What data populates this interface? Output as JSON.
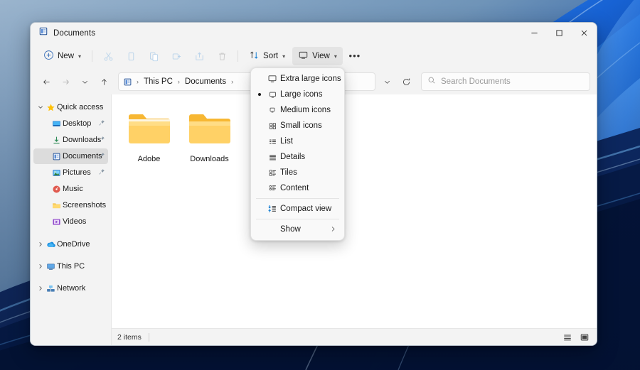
{
  "window": {
    "title": "Documents",
    "title_icon": "documents-folder-icon",
    "controls": {
      "minimize": "minimize-icon",
      "maximize": "maximize-icon",
      "close": "close-icon"
    }
  },
  "toolbar": {
    "new_label": "New",
    "new_icon": "plus-circle-icon",
    "actions": [
      {
        "name": "cut-button",
        "icon": "scissors-icon",
        "disabled": true
      },
      {
        "name": "copy-button",
        "icon": "copy-icon",
        "disabled": true
      },
      {
        "name": "paste-button",
        "icon": "paste-icon",
        "disabled": true
      },
      {
        "name": "rename-button",
        "icon": "rename-icon",
        "disabled": true
      },
      {
        "name": "share-button",
        "icon": "share-icon",
        "disabled": true
      },
      {
        "name": "delete-button",
        "icon": "trash-icon",
        "disabled": true
      }
    ],
    "sort_label": "Sort",
    "sort_icon": "sort-arrows-icon",
    "view_label": "View",
    "view_icon": "monitor-icon",
    "more_label": "•••",
    "view_active": true
  },
  "address": {
    "back_icon": "arrow-left-icon",
    "forward_icon": "arrow-right-icon",
    "recent_icon": "chevron-down-icon",
    "up_icon": "arrow-up-icon",
    "path_icon": "documents-folder-icon",
    "crumbs": [
      "This PC",
      "Documents"
    ],
    "separator": "›",
    "dropdown_icon": "chevron-down-icon",
    "refresh_icon": "refresh-icon"
  },
  "search": {
    "icon": "search-icon",
    "placeholder": "Search Documents",
    "value": ""
  },
  "sidebar": {
    "items": [
      {
        "label": "Quick access",
        "icon": "star-icon",
        "expandable": true,
        "expanded": true,
        "child": false,
        "pinned": false,
        "selected": false
      },
      {
        "label": "Desktop",
        "icon": "desktop-icon",
        "expandable": false,
        "expanded": false,
        "child": true,
        "pinned": true,
        "selected": false
      },
      {
        "label": "Downloads",
        "icon": "downloads-icon",
        "expandable": false,
        "expanded": false,
        "child": true,
        "pinned": true,
        "selected": false
      },
      {
        "label": "Documents",
        "icon": "documents-icon",
        "expandable": false,
        "expanded": false,
        "child": true,
        "pinned": true,
        "selected": true
      },
      {
        "label": "Pictures",
        "icon": "pictures-icon",
        "expandable": false,
        "expanded": false,
        "child": true,
        "pinned": true,
        "selected": false
      },
      {
        "label": "Music",
        "icon": "music-icon",
        "expandable": false,
        "expanded": false,
        "child": true,
        "pinned": false,
        "selected": false
      },
      {
        "label": "Screenshots",
        "icon": "folder-icon",
        "expandable": false,
        "expanded": false,
        "child": true,
        "pinned": false,
        "selected": false
      },
      {
        "label": "Videos",
        "icon": "videos-icon",
        "expandable": false,
        "expanded": false,
        "child": true,
        "pinned": false,
        "selected": false
      },
      {
        "label": "OneDrive",
        "icon": "onedrive-icon",
        "expandable": true,
        "expanded": false,
        "child": false,
        "pinned": false,
        "selected": false
      },
      {
        "label": "This PC",
        "icon": "this-pc-icon",
        "expandable": true,
        "expanded": false,
        "child": false,
        "pinned": false,
        "selected": false
      },
      {
        "label": "Network",
        "icon": "network-icon",
        "expandable": true,
        "expanded": false,
        "child": false,
        "pinned": false,
        "selected": false
      }
    ],
    "pin_icon": "pin-icon",
    "expand_glyph": "›",
    "collapse_glyph": "∨"
  },
  "files": [
    {
      "name": "Adobe",
      "type": "folder",
      "icon": "folder-icon"
    },
    {
      "name": "Downloads",
      "type": "folder",
      "icon": "folder-icon"
    }
  ],
  "statusbar": {
    "item_count": "2 items",
    "details_view_icon": "details-view-icon",
    "large_icons_view_icon": "large-icons-view-icon"
  },
  "view_menu": {
    "items": [
      {
        "label": "Extra large icons",
        "icon": "extra-large-icons-icon",
        "selected": false,
        "submenu": false,
        "separator_before": false,
        "accent": false
      },
      {
        "label": "Large icons",
        "icon": "large-icons-icon",
        "selected": true,
        "submenu": false,
        "separator_before": false,
        "accent": false
      },
      {
        "label": "Medium icons",
        "icon": "medium-icons-icon",
        "selected": false,
        "submenu": false,
        "separator_before": false,
        "accent": false
      },
      {
        "label": "Small icons",
        "icon": "small-icons-icon",
        "selected": false,
        "submenu": false,
        "separator_before": false,
        "accent": false
      },
      {
        "label": "List",
        "icon": "list-view-icon",
        "selected": false,
        "submenu": false,
        "separator_before": false,
        "accent": false
      },
      {
        "label": "Details",
        "icon": "details-view-icon",
        "selected": false,
        "submenu": false,
        "separator_before": false,
        "accent": false
      },
      {
        "label": "Tiles",
        "icon": "tiles-view-icon",
        "selected": false,
        "submenu": false,
        "separator_before": false,
        "accent": false
      },
      {
        "label": "Content",
        "icon": "content-view-icon",
        "selected": false,
        "submenu": false,
        "separator_before": false,
        "accent": false
      },
      {
        "label": "Compact view",
        "icon": "compact-view-icon",
        "selected": false,
        "submenu": false,
        "separator_before": true,
        "accent": true
      },
      {
        "label": "Show",
        "icon": "",
        "selected": false,
        "submenu": true,
        "separator_before": true,
        "accent": false
      }
    ],
    "submenu_arrow": "›"
  },
  "colors": {
    "accent": "#0078d4",
    "window_chrome": "#f3f3f3",
    "content_bg": "#ffffff",
    "selected_nav": "#dcdcdc",
    "folder_yellow": "#ffcf5a",
    "desktop_top": "#8aa8c4"
  }
}
